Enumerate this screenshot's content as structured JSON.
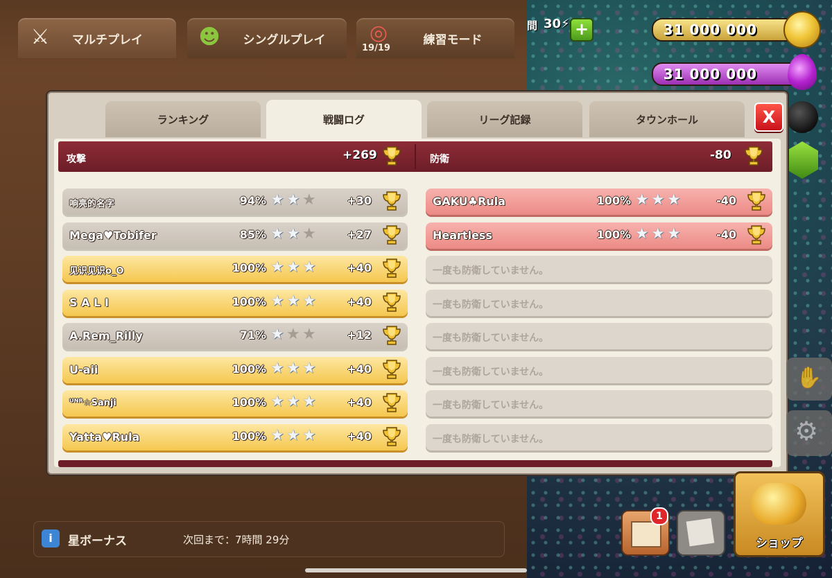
{
  "top_tabs": [
    {
      "label": "マルチプレイ",
      "icon": "crossed-swords-icon"
    },
    {
      "label": "シングルプレイ",
      "icon": "goblin-icon"
    },
    {
      "label": "練習モード",
      "icon": "target-icon",
      "badge": "19/19"
    }
  ],
  "resources": {
    "timer_label": "間",
    "timer_value": "30⚡",
    "gold": "31 000 000",
    "elixir": "31 000 000"
  },
  "modal": {
    "tabs": [
      "ランキング",
      "戦闘ログ",
      "リーグ記録",
      "タウンホール"
    ],
    "active_tab": "戦闘ログ",
    "close_label": "X",
    "attack_label": "攻撃",
    "attack_total": "+269",
    "defense_label": "防衛",
    "defense_total": "-80",
    "attacks": [
      {
        "name": "响亮的名字",
        "pct": "94%",
        "stars": 2,
        "trophies": "+30",
        "style": "grey"
      },
      {
        "name": "Mega♥Tobifer",
        "pct": "85%",
        "stars": 2,
        "trophies": "+27",
        "style": "grey"
      },
      {
        "name": "见识见识o_O",
        "pct": "100%",
        "stars": 3,
        "trophies": "+40",
        "style": "gold"
      },
      {
        "name": "S A L I",
        "pct": "100%",
        "stars": 3,
        "trophies": "+40",
        "style": "gold"
      },
      {
        "name": "A.Rem_Rilly",
        "pct": "71%",
        "stars": 1,
        "trophies": "+12",
        "style": "grey"
      },
      {
        "name": "U-aii",
        "pct": "100%",
        "stars": 3,
        "trophies": "+40",
        "style": "gold"
      },
      {
        "name": "ᵁᴺᴿ☆Sanji",
        "pct": "100%",
        "stars": 3,
        "trophies": "+40",
        "style": "gold"
      },
      {
        "name": "Yatta♥Rula",
        "pct": "100%",
        "stars": 3,
        "trophies": "+40",
        "style": "gold"
      }
    ],
    "defenses": [
      {
        "name": "GAKU♣Rula",
        "pct": "100%",
        "stars": 3,
        "trophies": "-40",
        "style": "red"
      },
      {
        "name": "Heartless",
        "pct": "100%",
        "stars": 3,
        "trophies": "-40",
        "style": "red"
      },
      {
        "empty_text": "一度も防衛していません。"
      },
      {
        "empty_text": "一度も防衛していません。"
      },
      {
        "empty_text": "一度も防衛していません。"
      },
      {
        "empty_text": "一度も防衛していません。"
      },
      {
        "empty_text": "一度も防衛していません。"
      },
      {
        "empty_text": "一度も防衛していません。"
      }
    ]
  },
  "bottom": {
    "info_icon": "i",
    "star_bonus_label": "星ボーナス",
    "next_label": "次回まで：7時間 29分"
  },
  "side_buttons": {
    "inbox_badge": "1",
    "shop_label": "ショップ"
  },
  "colors": {
    "attack_bar": "#8e2c37",
    "gold_row": "#f5c74f",
    "red_row": "#ec8a85",
    "close_button": "#e0252b"
  }
}
